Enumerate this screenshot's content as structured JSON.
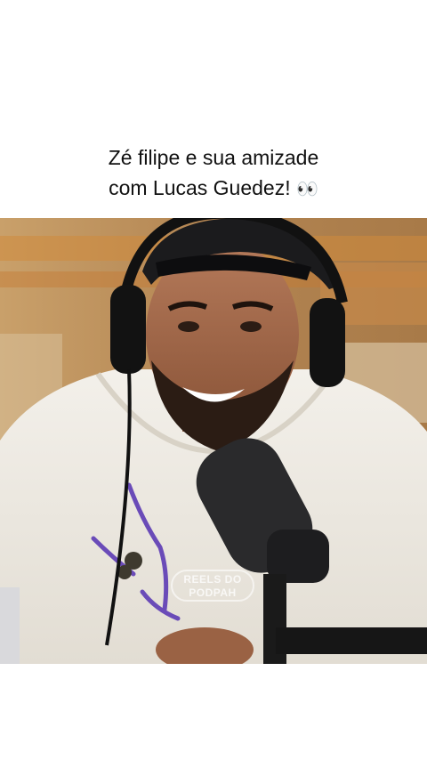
{
  "caption": {
    "line1": "Zé filipe e sua amizade",
    "line2": "com Lucas Guedez!",
    "emoji": "👀"
  },
  "video": {
    "watermark_line1": "REELS DO",
    "watermark_line2": "PODPAH"
  }
}
